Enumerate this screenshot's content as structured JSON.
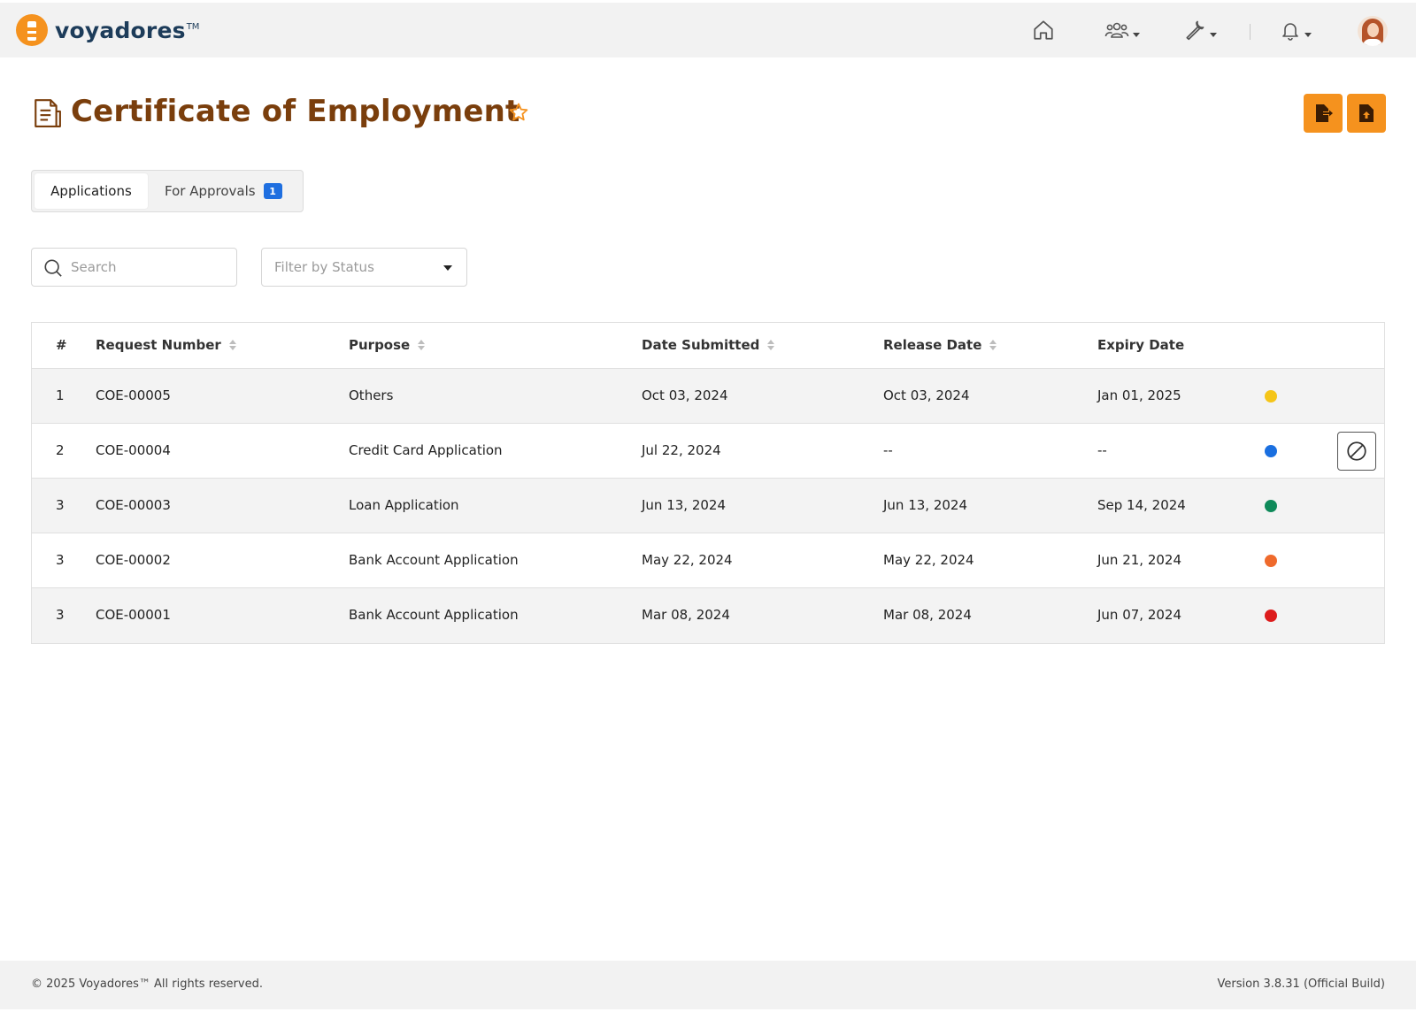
{
  "brand": {
    "name": "voyadores",
    "tm": "TM"
  },
  "nav": {
    "items": [
      {
        "name": "home",
        "icon": "home-icon"
      },
      {
        "name": "people",
        "icon": "users-icon",
        "has_dropdown": true
      },
      {
        "name": "tools",
        "icon": "wrench-icon",
        "has_dropdown": true
      },
      {
        "name": "notifications",
        "icon": "bell-icon",
        "has_dropdown": true
      }
    ],
    "avatar": "user-avatar"
  },
  "page": {
    "title": "Certificate of Employment",
    "icon": "document-icon",
    "favorite_icon": "star-icon",
    "actions": [
      {
        "name": "export",
        "icon": "file-export-icon"
      },
      {
        "name": "upload",
        "icon": "file-upload-icon"
      }
    ]
  },
  "tabs": {
    "applications": "Applications",
    "for_approvals": "For Approvals",
    "for_approvals_count": "1"
  },
  "filters": {
    "search_placeholder": "Search",
    "status_placeholder": "Filter by Status"
  },
  "table": {
    "headers": {
      "num": "#",
      "request_number": "Request Number",
      "purpose": "Purpose",
      "date_submitted": "Date Submitted",
      "release_date": "Release Date",
      "expiry_date": "Expiry Date"
    },
    "rows": [
      {
        "num": "1",
        "request_number": "COE-00005",
        "purpose": "Others",
        "date_submitted": "Oct 03, 2024",
        "release_date": "Oct 03, 2024",
        "expiry_date": "Jan 01, 2025",
        "status_color": "#f5c518",
        "can_cancel": false
      },
      {
        "num": "2",
        "request_number": "COE-00004",
        "purpose": "Credit Card Application",
        "date_submitted": "Jul 22, 2024",
        "release_date": "--",
        "expiry_date": "--",
        "status_color": "#1a6fe0",
        "can_cancel": true
      },
      {
        "num": "3",
        "request_number": "COE-00003",
        "purpose": "Loan Application",
        "date_submitted": "Jun 13, 2024",
        "release_date": "Jun 13, 2024",
        "expiry_date": "Sep 14, 2024",
        "status_color": "#0f8a5a",
        "can_cancel": false
      },
      {
        "num": "3",
        "request_number": "COE-00002",
        "purpose": "Bank Account Application",
        "date_submitted": "May 22, 2024",
        "release_date": "May 22, 2024",
        "expiry_date": "Jun 21, 2024",
        "status_color": "#ef6a2c",
        "can_cancel": false
      },
      {
        "num": "3",
        "request_number": "COE-00001",
        "purpose": "Bank Account Application",
        "date_submitted": "Mar 08, 2024",
        "release_date": "Mar 08, 2024",
        "expiry_date": "Jun 07, 2024",
        "status_color": "#dd1c1c",
        "can_cancel": false
      }
    ]
  },
  "footer": {
    "copyright": "© 2025 Voyadores™ All rights reserved.",
    "version": "Version 3.8.31 (Official Build)"
  },
  "colors": {
    "accent": "#f5921e",
    "title": "#7a3e0c",
    "brand_text": "#1d3c5a",
    "badge": "#1f6fe0"
  }
}
